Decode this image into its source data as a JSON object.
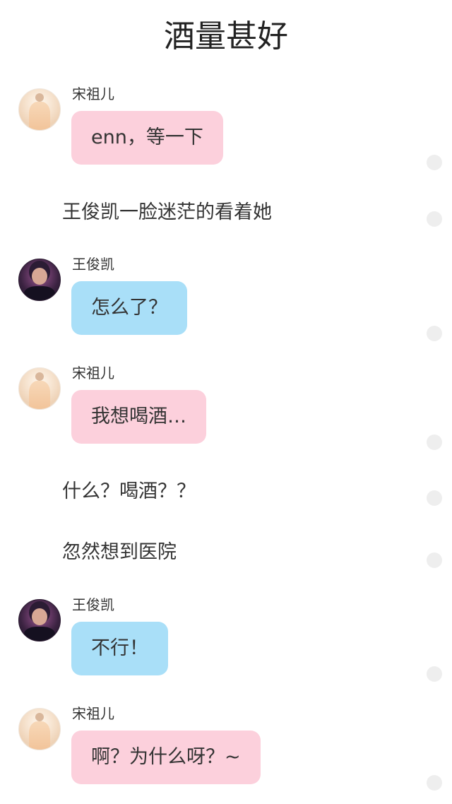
{
  "header": {
    "title": "酒量甚好"
  },
  "messages": [
    {
      "type": "chat",
      "speaker": "宋祖儿",
      "text": "enn，等一下",
      "bubble_color": "#fcd0dc"
    },
    {
      "type": "narration",
      "text": "王俊凯一脸迷茫的看着她"
    },
    {
      "type": "chat",
      "speaker": "王俊凯",
      "text": "怎么了？",
      "bubble_color": "#a9dff8"
    },
    {
      "type": "chat",
      "speaker": "宋祖儿",
      "text": "我想喝酒…",
      "bubble_color": "#fcd0dc"
    },
    {
      "type": "narration",
      "text": "什么？喝酒？？"
    },
    {
      "type": "narration",
      "text": "忽然想到医院"
    },
    {
      "type": "chat",
      "speaker": "王俊凯",
      "text": "不行！",
      "bubble_color": "#a9dff8"
    },
    {
      "type": "chat",
      "speaker": "宋祖儿",
      "text": "啊？为什么呀？~",
      "bubble_color": "#fcd0dc"
    }
  ],
  "avatars": {
    "female": {
      "icon": "female-avatar-icon"
    },
    "male": {
      "icon": "male-avatar-icon"
    }
  },
  "colors": {
    "pink_bubble": "#fcd0dc",
    "blue_bubble": "#a9dff8",
    "side_dot": "#eeeeee"
  }
}
